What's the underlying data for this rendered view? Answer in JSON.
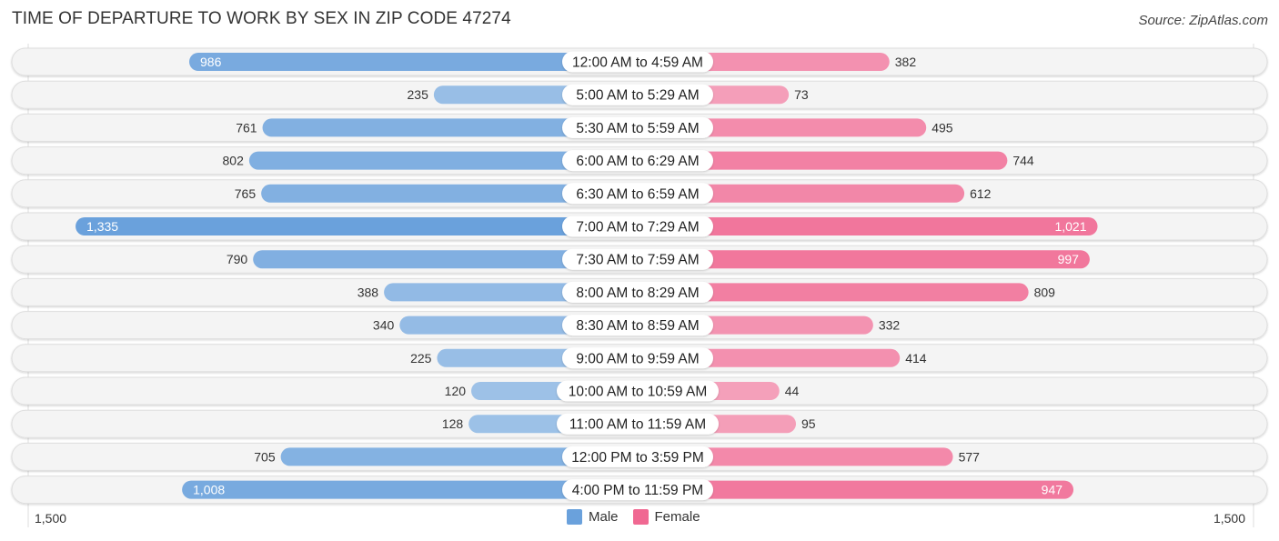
{
  "chart_data": {
    "type": "bar",
    "orientation": "horizontal-diverging",
    "title": "TIME OF DEPARTURE TO WORK BY SEX IN ZIP CODE 47274",
    "source": "Source: ZipAtlas.com",
    "categories": [
      "12:00 AM to 4:59 AM",
      "5:00 AM to 5:29 AM",
      "5:30 AM to 5:59 AM",
      "6:00 AM to 6:29 AM",
      "6:30 AM to 6:59 AM",
      "7:00 AM to 7:29 AM",
      "7:30 AM to 7:59 AM",
      "8:00 AM to 8:29 AM",
      "8:30 AM to 8:59 AM",
      "9:00 AM to 9:59 AM",
      "10:00 AM to 10:59 AM",
      "11:00 AM to 11:59 AM",
      "12:00 PM to 3:59 PM",
      "4:00 PM to 11:59 PM"
    ],
    "series": [
      {
        "name": "Male",
        "color": "#6aa1dc",
        "color_light": "#a8c8ea",
        "values": [
          986,
          235,
          761,
          802,
          765,
          1335,
          790,
          388,
          340,
          225,
          120,
          128,
          705,
          1008
        ],
        "labels": [
          "986",
          "235",
          "761",
          "802",
          "765",
          "1,335",
          "790",
          "388",
          "340",
          "225",
          "120",
          "128",
          "705",
          "1,008"
        ]
      },
      {
        "name": "Female",
        "color": "#f06892",
        "color_light": "#f5a8c0",
        "values": [
          382,
          73,
          495,
          744,
          612,
          1021,
          997,
          809,
          332,
          414,
          44,
          95,
          577,
          947
        ],
        "labels": [
          "382",
          "73",
          "495",
          "744",
          "612",
          "1,021",
          "997",
          "809",
          "332",
          "414",
          "44",
          "95",
          "577",
          "947"
        ]
      }
    ],
    "axis": {
      "left_label": "1,500",
      "right_label": "1,500",
      "xlim": [
        -1500,
        1500
      ]
    },
    "legend": {
      "position": "bottom-center",
      "items": [
        "Male",
        "Female"
      ]
    },
    "grid": false
  }
}
